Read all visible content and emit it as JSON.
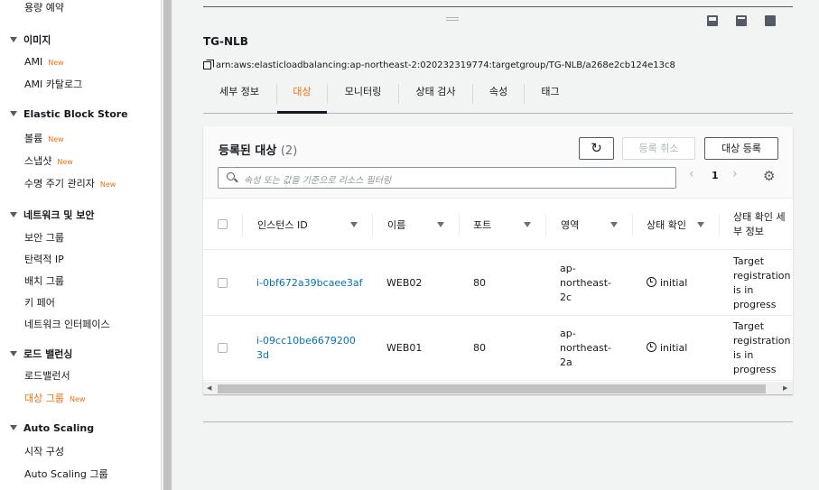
{
  "sidebar": {
    "top_item": "용량 예약",
    "sections": [
      {
        "title": "이미지",
        "items": [
          {
            "label": "AMI",
            "badge": "New"
          },
          {
            "label": "AMI 카탈로그",
            "badge": ""
          }
        ]
      },
      {
        "title": "Elastic Block Store",
        "items": [
          {
            "label": "볼륨",
            "badge": "New"
          },
          {
            "label": "스냅샷",
            "badge": "New"
          },
          {
            "label": "수명 주기 관리자",
            "badge": "New"
          }
        ]
      },
      {
        "title": "네트워크 및 보안",
        "items": [
          {
            "label": "보안 그룹",
            "badge": ""
          },
          {
            "label": "탄력적 IP",
            "badge": ""
          },
          {
            "label": "배치 그룹",
            "badge": ""
          },
          {
            "label": "키 페어",
            "badge": ""
          },
          {
            "label": "네트워크 인터페이스",
            "badge": ""
          }
        ]
      },
      {
        "title": "로드 밸런싱",
        "items": [
          {
            "label": "로드밸런서",
            "badge": ""
          },
          {
            "label": "대상 그룹",
            "badge": "New"
          }
        ]
      },
      {
        "title": "Auto Scaling",
        "items": [
          {
            "label": "시작 구성",
            "badge": ""
          },
          {
            "label": "Auto Scaling 그룹",
            "badge": ""
          }
        ]
      }
    ]
  },
  "detail": {
    "title": "TG-NLB",
    "arn": "arn:aws:elasticloadbalancing:ap-northeast-2:020232319774:targetgroup/TG-NLB/a268e2cb124e13c8",
    "tabs": [
      "세부 정보",
      "대상",
      "모니터링",
      "상태 검사",
      "속성",
      "태그"
    ],
    "active_tab": "대상"
  },
  "targets": {
    "title": "등록된 대상",
    "count": "(2)",
    "deregister_label": "등록 취소",
    "register_label": "대상 등록",
    "search_placeholder": "속성 또는 값을 기준으로 리소스 필터링",
    "page": "1",
    "columns": [
      "인스턴스 ID",
      "이름",
      "포트",
      "영역",
      "상태 확인",
      "상태 확인 세부 정보"
    ],
    "rows": [
      {
        "instance_id": "i-0bf672a39bcaee3af",
        "name": "WEB02",
        "port": "80",
        "zone": "ap-northeast-2c",
        "health": "initial",
        "details": "Target registration is in progress"
      },
      {
        "instance_id": "i-09cc10be66792003d",
        "name": "WEB01",
        "port": "80",
        "zone": "ap-northeast-2a",
        "health": "initial",
        "details": "Target registration is in progress"
      }
    ]
  },
  "colors": {
    "accent": "#ec7211",
    "link": "#0073bb",
    "text": "#16191f"
  }
}
